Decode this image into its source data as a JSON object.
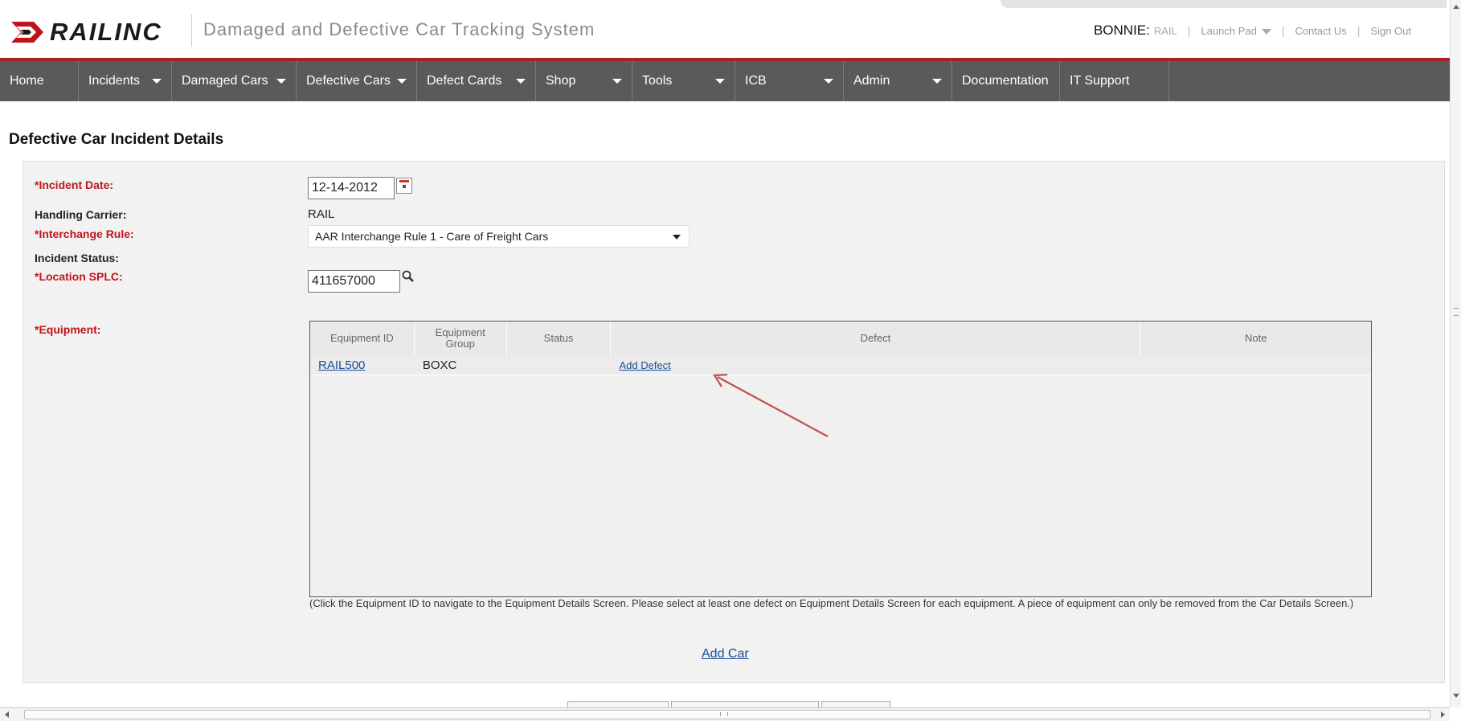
{
  "header": {
    "logo_text": "RAILINC",
    "app_title": "Damaged and Defective Car Tracking System",
    "user_name": "BONNIE:",
    "user_org": "RAIL",
    "launch_pad": "Launch Pad",
    "contact_us": "Contact Us",
    "sign_out": "Sign Out"
  },
  "nav": {
    "items": [
      {
        "label": "Home"
      },
      {
        "label": "Incidents"
      },
      {
        "label": "Damaged Cars"
      },
      {
        "label": "Defective Cars"
      },
      {
        "label": "Defect Cards"
      },
      {
        "label": "Shop"
      },
      {
        "label": "Tools"
      },
      {
        "label": "ICB"
      },
      {
        "label": "Admin"
      },
      {
        "label": "Documentation"
      },
      {
        "label": "IT Support"
      }
    ]
  },
  "page": {
    "title": "Defective Car Incident Details"
  },
  "form": {
    "incident_date_label": "*Incident Date:",
    "incident_date_value": "12-14-2012",
    "handling_carrier_label": "Handling Carrier:",
    "handling_carrier_value": "RAIL",
    "interchange_rule_label": "*Interchange Rule:",
    "interchange_rule_value": "AAR Interchange Rule 1 - Care of Freight Cars",
    "incident_status_label": "Incident Status:",
    "location_splc_label": "*Location SPLC:",
    "location_splc_value": "411657000",
    "equipment_label": "*Equipment:"
  },
  "equipment_table": {
    "columns": [
      "Equipment ID",
      "Equipment Group",
      "Status",
      "Defect",
      "Note"
    ],
    "rows": [
      {
        "equipment_id": "RAIL500",
        "equipment_group": "BOXC",
        "status": "",
        "defect": "Add Defect",
        "note": ""
      }
    ],
    "help_text": "(Click the Equipment ID to navigate to the Equipment Details Screen. Please select at least one defect on Equipment Details Screen for each equipment. A piece of equipment can only be removed from the Car Details Screen.)",
    "add_car_label": "Add Car"
  },
  "colors": {
    "nav_bg": "#5a5a5a",
    "nav_accent": "#a82020",
    "required_label": "#c0141c",
    "link": "#1a4c96",
    "annotation_arrow": "#c0504d"
  }
}
